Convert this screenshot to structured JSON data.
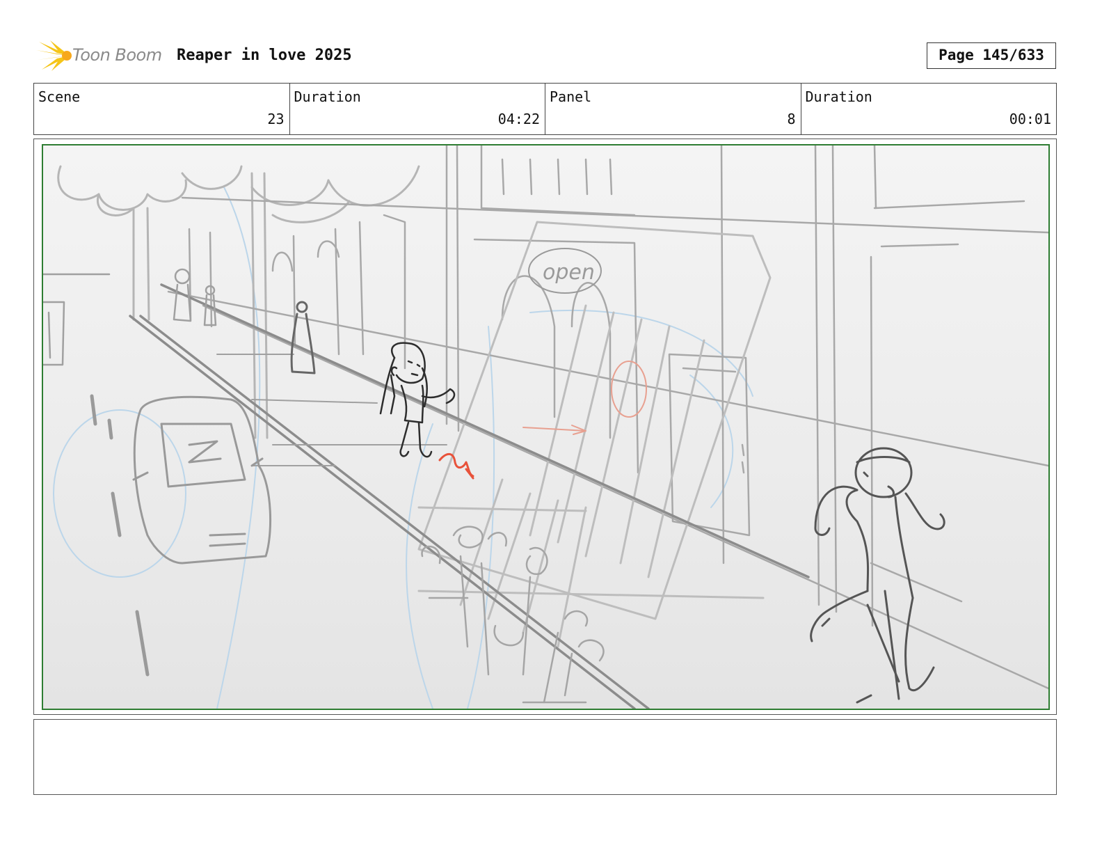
{
  "header": {
    "logo_text": "Toon Boom",
    "logo_icon": "sunburst-logo-icon",
    "project_title": "Reaper in love 2025",
    "page_label": "Page 145/633"
  },
  "info": {
    "scene": {
      "label": "Scene",
      "value": "23"
    },
    "scene_duration": {
      "label": "Duration",
      "value": "04:22"
    },
    "panel": {
      "label": "Panel",
      "value": "8"
    },
    "panel_duration": {
      "label": "Duration",
      "value": "00:01"
    }
  },
  "colors": {
    "logo_yellow": "#f5c518",
    "panel_border": "#2e7d32",
    "sketch_gray": "#9a9a9a",
    "sketch_dark": "#333333",
    "sketch_blue": "#bcd6ea",
    "sketch_red": "#e8523a"
  },
  "notes": {
    "text": ""
  }
}
